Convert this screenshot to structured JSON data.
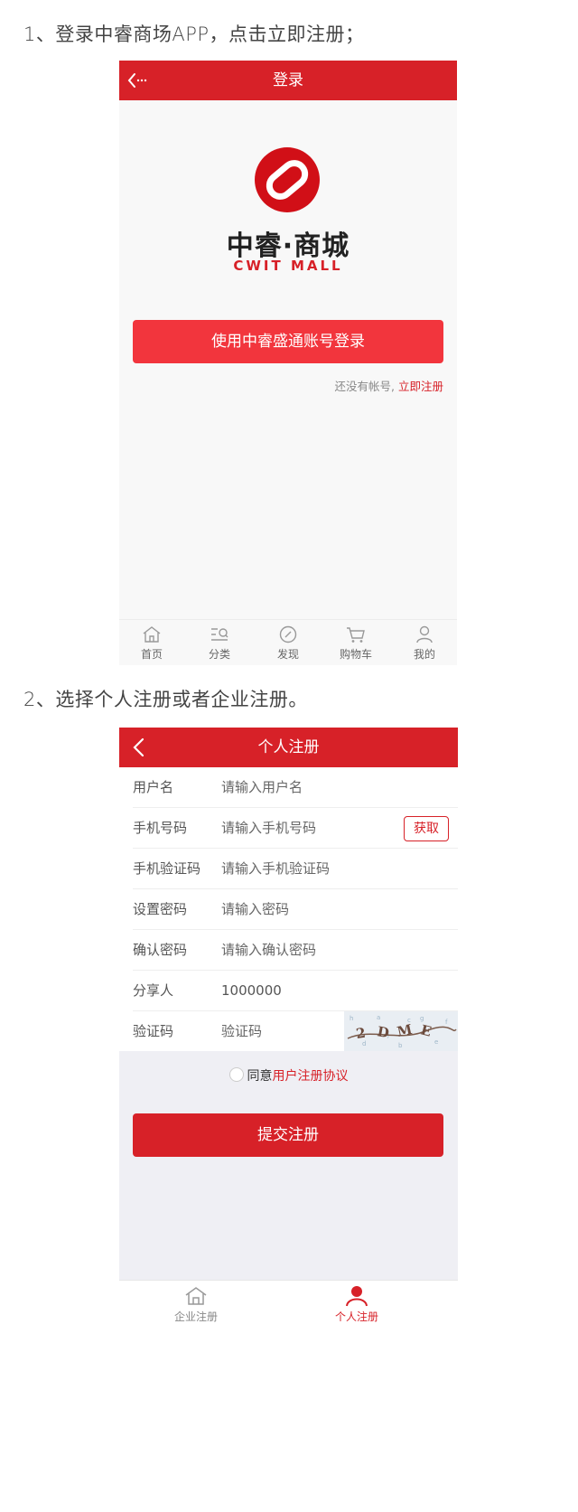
{
  "steps": {
    "step1": "1、登录中睿商场APP，点击立即注册；",
    "step2": "2、选择个人注册或者企业注册。"
  },
  "login_screen": {
    "title": "登录",
    "logo_cn": "中睿·商城",
    "logo_en": "CWIT  MALL",
    "login_button": "使用中睿盛通账号登录",
    "no_account_text": "还没有帐号,",
    "register_link": "立即注册",
    "tabbar": [
      {
        "label": "首页",
        "icon": "home-icon"
      },
      {
        "label": "分类",
        "icon": "category-icon"
      },
      {
        "label": "发现",
        "icon": "compass-icon"
      },
      {
        "label": "购物车",
        "icon": "cart-icon"
      },
      {
        "label": "我的",
        "icon": "user-icon"
      }
    ]
  },
  "register_screen": {
    "title": "个人注册",
    "fields": {
      "username": {
        "label": "用户名",
        "placeholder": "请输入用户名"
      },
      "phone": {
        "label": "手机号码",
        "placeholder": "请输入手机号码",
        "button": "获取"
      },
      "sms_code": {
        "label": "手机验证码",
        "placeholder": "请输入手机验证码"
      },
      "password": {
        "label": "设置密码",
        "placeholder": "请输入密码"
      },
      "confirm_password": {
        "label": "确认密码",
        "placeholder": "请输入确认密码"
      },
      "referrer": {
        "label": "分享人",
        "value": "1000000"
      },
      "captcha": {
        "label": "验证码",
        "placeholder": "验证码"
      }
    },
    "agree_text": "同意",
    "agreement_link": "用户注册协议",
    "submit_button": "提交注册",
    "tabbar": [
      {
        "label": "企业注册",
        "icon": "home-icon"
      },
      {
        "label": "个人注册",
        "icon": "user-icon",
        "active": true
      }
    ]
  },
  "colors": {
    "brand_red": "#d72128",
    "button_red": "#f2353d"
  }
}
